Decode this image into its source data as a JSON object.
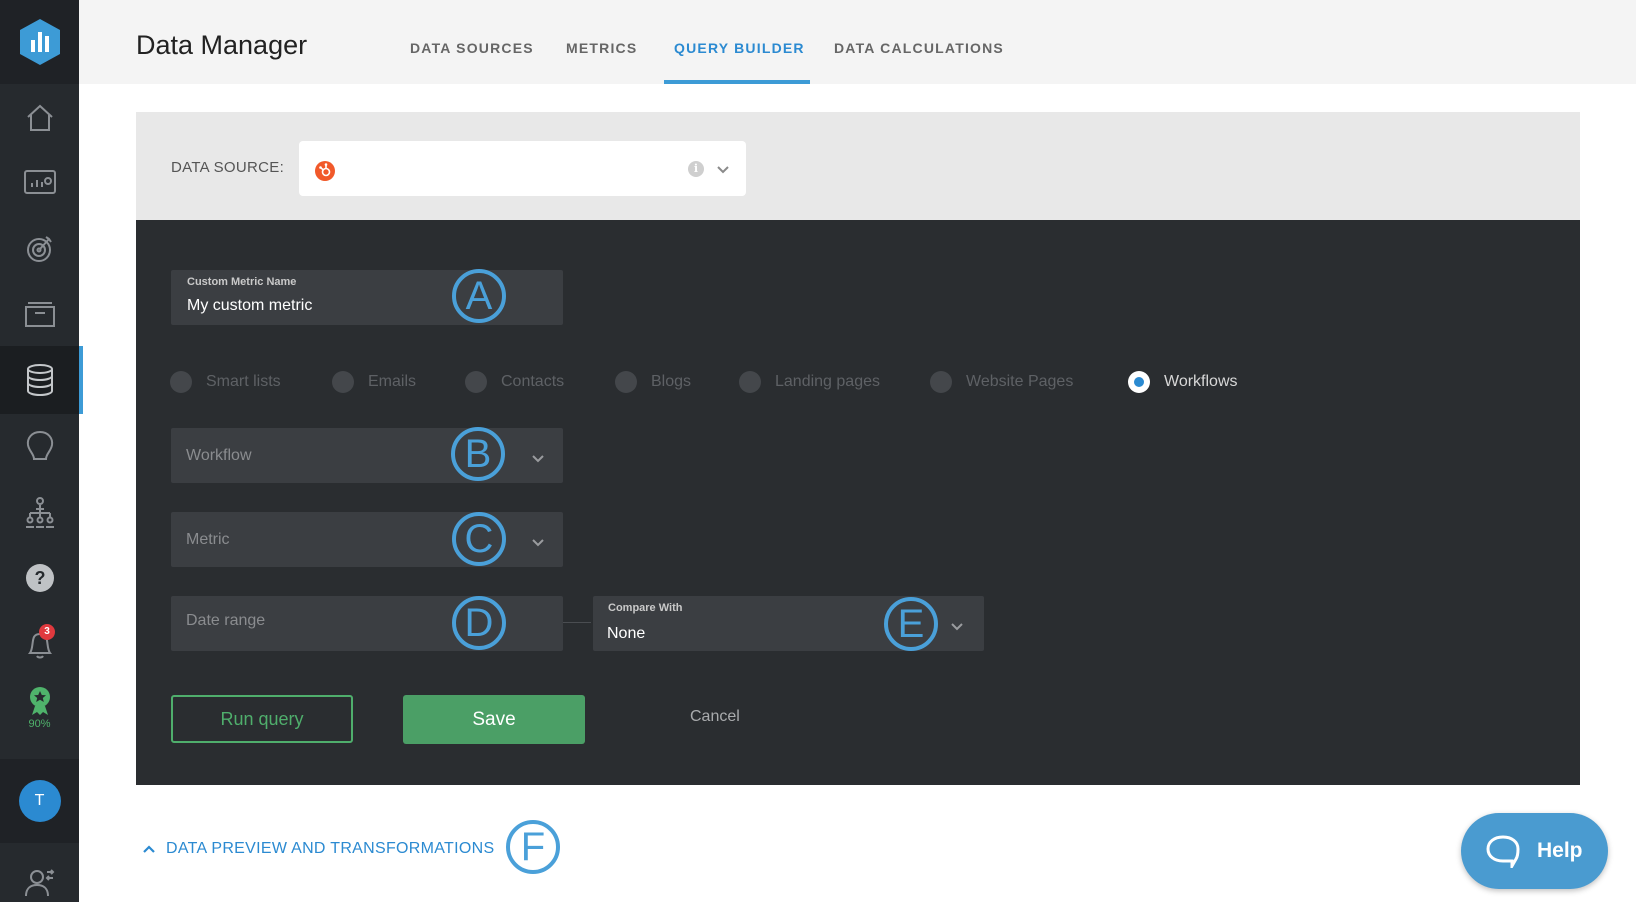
{
  "app": {
    "title": "Data Manager",
    "tabs": [
      {
        "label": "DATA SOURCES"
      },
      {
        "label": "METRICS"
      },
      {
        "label": "QUERY BUILDER",
        "active": true
      },
      {
        "label": "DATA CALCULATIONS"
      }
    ]
  },
  "sidebar": {
    "items": [
      "home-icon",
      "dashboard-icon",
      "goals-icon",
      "folder-icon",
      "database-icon",
      "lightbulb-icon",
      "org-chart-icon",
      "help-icon",
      "notifications-icon",
      "achievements-icon",
      "account-icon"
    ],
    "notification_count": "3",
    "progress": "90%",
    "avatar_initial": "T"
  },
  "data_source": {
    "label": "DATA SOURCE:",
    "selected_icon": "hubspot-icon"
  },
  "query_builder": {
    "custom_metric_label": "Custom Metric Name",
    "custom_metric_value": "My custom metric",
    "radio_options": [
      {
        "label": "Smart lists"
      },
      {
        "label": "Emails"
      },
      {
        "label": "Contacts"
      },
      {
        "label": "Blogs"
      },
      {
        "label": "Landing pages"
      },
      {
        "label": "Website Pages"
      },
      {
        "label": "Workflows",
        "selected": true
      }
    ],
    "workflow_placeholder": "Workflow",
    "metric_placeholder": "Metric",
    "date_range_placeholder": "Date range",
    "compare_label": "Compare With",
    "compare_value": "None",
    "run_query_label": "Run query",
    "save_label": "Save",
    "cancel_label": "Cancel"
  },
  "markers": {
    "a": "A",
    "b": "B",
    "c": "C",
    "d": "D",
    "e": "E",
    "f": "F"
  },
  "preview": {
    "label": "DATA PREVIEW AND TRANSFORMATIONS"
  },
  "help": {
    "label": "Help"
  },
  "colors": {
    "accent": "#2b8ad1",
    "sidebar": "#262a2e",
    "panel": "#2a2d30",
    "save": "#4b9f66",
    "marker": "#4aa0d9"
  }
}
